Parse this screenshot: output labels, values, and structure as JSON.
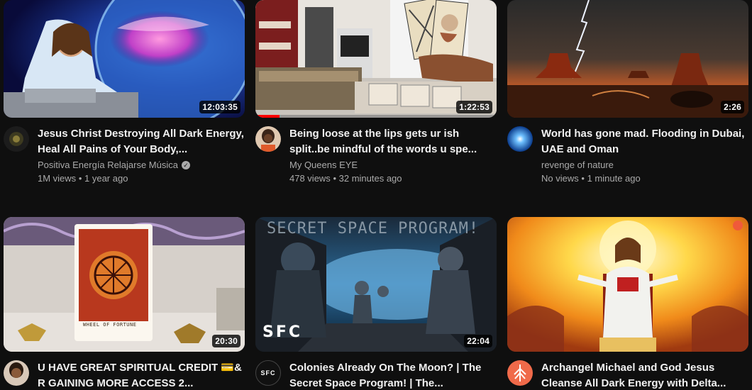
{
  "videos": [
    {
      "title": "Jesus Christ Destroying All Dark Energy, Heal All Pains of Your Body,...",
      "channel": "Positiva Energía Relajarse Música",
      "verified": true,
      "views": "1M views",
      "age": "1 year ago",
      "duration": "12:03:35"
    },
    {
      "title": "Being loose at the lips gets ur ish split..be mindful of the words u spe...",
      "channel": "My Queens EYE",
      "verified": false,
      "views": "478 views",
      "age": "32 minutes ago",
      "duration": "1:22:53",
      "watched_fraction": 0.1
    },
    {
      "title": "World has gone mad. Flooding in Dubai, UAE and Oman",
      "channel": "revenge of nature",
      "verified": false,
      "views": "No views",
      "age": "1 minute ago",
      "duration": "2:26"
    },
    {
      "title": "U HAVE GREAT SPIRITUAL CREDIT 💳& R GAINING MORE ACCESS 2...",
      "channel": "",
      "verified": false,
      "views": "",
      "age": "",
      "duration": "20:30",
      "thumb_text": "WHEEL OF FORTUNE"
    },
    {
      "title": "Colonies Already On The Moon? | The Secret Space Program! | The...",
      "channel": "",
      "verified": false,
      "views": "",
      "age": "",
      "duration": "22:04",
      "thumb_text": "SECRET SPACE PROGRAM!",
      "thumb_logo": "SFC",
      "avatar_text": "SFC"
    },
    {
      "title": "Archangel Michael and God Jesus Cleanse All Dark Energy with Delta...",
      "channel": "",
      "verified": false,
      "views": "",
      "age": "",
      "duration": ""
    }
  ],
  "separator": "•",
  "verified_glyph": "✓"
}
